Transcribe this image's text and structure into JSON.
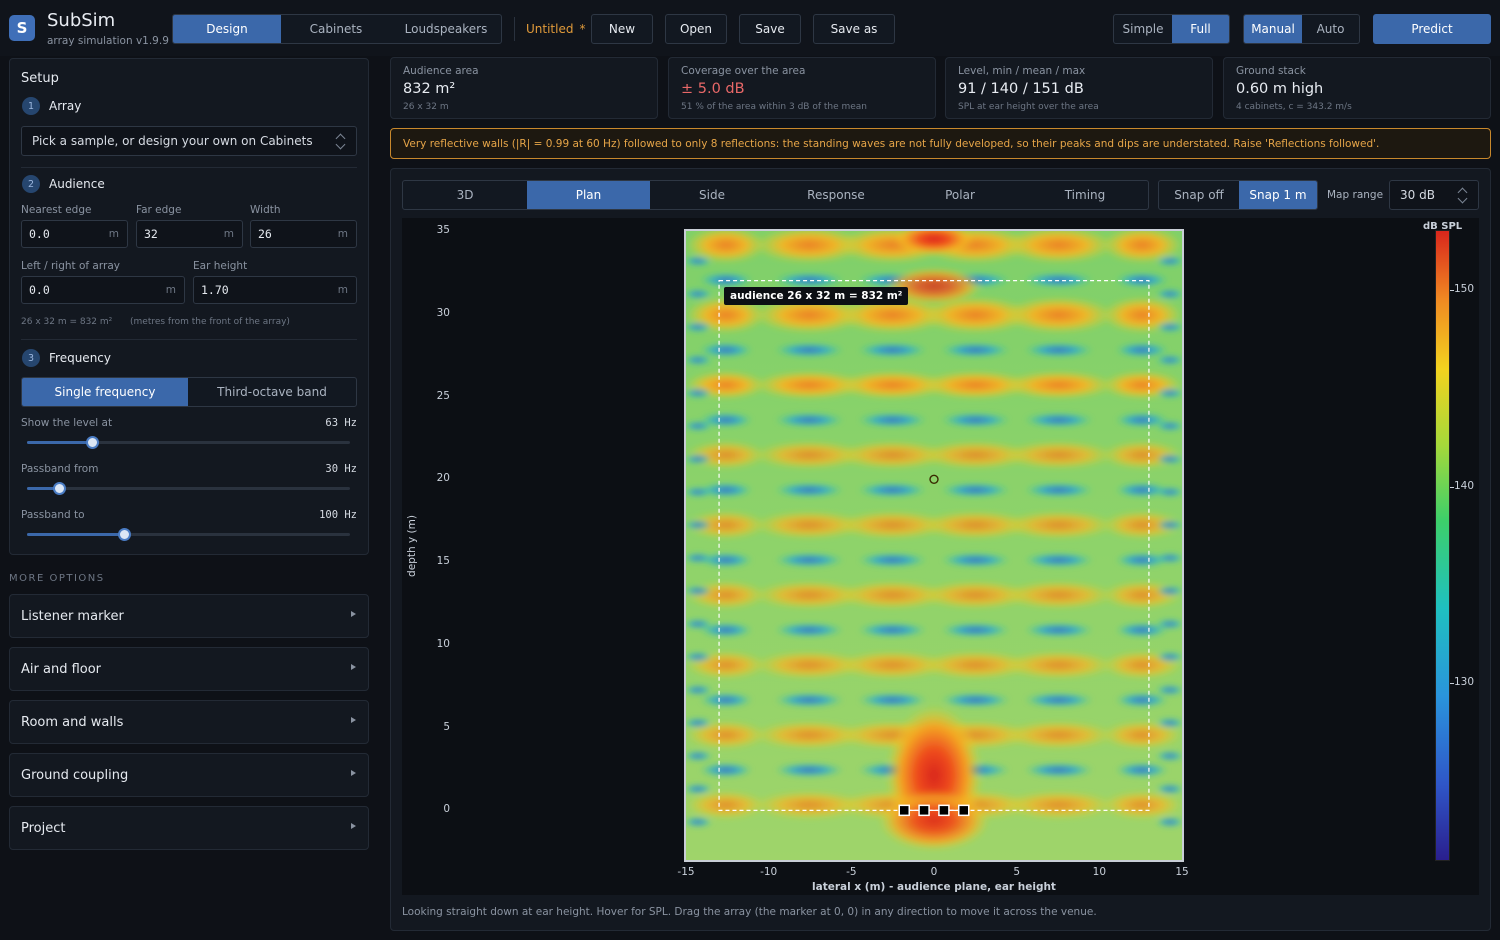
{
  "app": {
    "name": "SubSim",
    "subtitle": "array simulation",
    "version": "v1.9.9",
    "logo": "S"
  },
  "nav_tabs": [
    {
      "label": "Design",
      "active": true
    },
    {
      "label": "Cabinets",
      "active": false
    },
    {
      "label": "Loudspeakers",
      "active": false
    }
  ],
  "doc": {
    "name": "Untitled",
    "modified_mark": "*"
  },
  "file_buttons": {
    "new": "New",
    "open": "Open",
    "save": "Save",
    "save_as": "Save as"
  },
  "mode": [
    {
      "label": "Simple",
      "active": false
    },
    {
      "label": "Full",
      "active": true
    }
  ],
  "control": [
    {
      "label": "Manual",
      "active": true
    },
    {
      "label": "Auto",
      "active": false
    }
  ],
  "predict_label": "Predict",
  "setup": {
    "title": "Setup",
    "array": {
      "num": "1",
      "title": "Array",
      "select_value": "Pick a sample, or design your own on Cabinets"
    },
    "audience": {
      "num": "2",
      "title": "Audience",
      "nearest_label": "Nearest edge",
      "nearest_value": "0.0",
      "far_label": "Far edge",
      "far_value": "32",
      "width_label": "Width",
      "width_value": "26",
      "lr_label": "Left / right of array",
      "lr_value": "0.0",
      "ear_label": "Ear height",
      "ear_value": "1.70",
      "unit": "m",
      "summary": "26 x 32 m  =  832 m²",
      "note": "(metres from the front of the array)"
    },
    "frequency": {
      "num": "3",
      "title": "Frequency",
      "modes": [
        {
          "label": "Single frequency",
          "active": true
        },
        {
          "label": "Third-octave band",
          "active": false
        }
      ],
      "sliders": [
        {
          "label": "Show the level at",
          "value": "63 Hz",
          "fraction": 0.2
        },
        {
          "label": "Passband from",
          "value": "30 Hz",
          "fraction": 0.1
        },
        {
          "label": "Passband to",
          "value": "100 Hz",
          "fraction": 0.3
        }
      ]
    }
  },
  "more_options": {
    "title": "MORE OPTIONS",
    "items": [
      "Listener marker",
      "Air and floor",
      "Room and walls",
      "Ground coupling",
      "Project"
    ]
  },
  "cards": [
    {
      "key": "Audience area",
      "value": "832 m²",
      "note": "26 x 32 m",
      "alert": false
    },
    {
      "key": "Coverage over the area",
      "value": "± 5.0 dB",
      "note": "51 % of the area within 3 dB of the mean",
      "alert": true
    },
    {
      "key": "Level, min / mean / max",
      "value": "91 / 140 / 151 dB",
      "note": "SPL at ear height over the area",
      "alert": false
    },
    {
      "key": "Ground stack",
      "value": "0.60 m high",
      "note": "4 cabinets, c = 343.2 m/s",
      "alert": false
    }
  ],
  "warning": "Very reflective walls (|R| = 0.99 at 60 Hz) followed to only 8 reflections: the standing waves are not fully developed, so their peaks and dips are understated. Raise 'Reflections followed'.",
  "view_tabs": [
    {
      "label": "3D",
      "active": false
    },
    {
      "label": "Plan",
      "active": true
    },
    {
      "label": "Side",
      "active": false
    },
    {
      "label": "Response",
      "active": false
    },
    {
      "label": "Polar",
      "active": false
    },
    {
      "label": "Timing",
      "active": false
    }
  ],
  "snap": [
    {
      "label": "Snap off",
      "active": false
    },
    {
      "label": "Snap 1 m",
      "active": true
    }
  ],
  "map_range": {
    "label": "Map range",
    "value": "30 dB"
  },
  "plot": {
    "audience_tag": "audience 26 x 32 m  =  832 m²",
    "ylabel": "depth  y (m)",
    "xlabel": "lateral  x (m)   -   audience plane, ear height",
    "colorbar_label": "dB SPL",
    "x_ticks": [
      "-15",
      "-10",
      "-5",
      "0",
      "5",
      "10",
      "15"
    ],
    "y_ticks": [
      "35",
      "30",
      "25",
      "20",
      "15",
      "10",
      "5",
      "0"
    ],
    "c_ticks": [
      "150",
      "140",
      "130"
    ],
    "x_range": [
      -15,
      15
    ],
    "y_range": [
      -3,
      35
    ],
    "audience_box": {
      "x": [
        -13,
        13
      ],
      "y": [
        0,
        32
      ]
    },
    "listener": {
      "x": 0,
      "y": 20
    },
    "array_x": [
      -1.8,
      -0.6,
      0.6,
      1.8
    ],
    "array_y": 0,
    "c_range": [
      121,
      153
    ]
  },
  "footer": "Looking straight down at ear height. Hover for SPL. Drag the array (the marker at 0, 0) in any direction to move it across the venue."
}
